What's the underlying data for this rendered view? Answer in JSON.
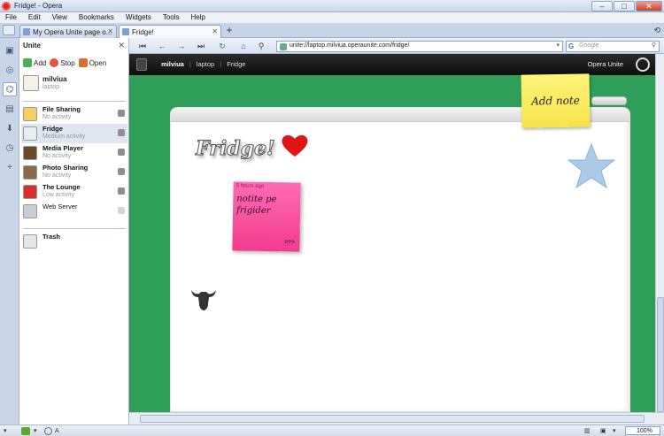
{
  "window": {
    "title": "Fridge! - Opera"
  },
  "menu": [
    "File",
    "Edit",
    "View",
    "Bookmarks",
    "Widgets",
    "Tools",
    "Help"
  ],
  "tabs": [
    {
      "label": "My Opera Unite page o...",
      "active": false
    },
    {
      "label": "Fridge!",
      "active": true
    }
  ],
  "panel": {
    "title": "Unite",
    "toolbar": {
      "add": "Add",
      "stop": "Stop",
      "open": "Open"
    },
    "owner": {
      "name": "milviua",
      "device": "laptop"
    },
    "services": [
      {
        "name": "File Sharing",
        "status": "No activity"
      },
      {
        "name": "Fridge",
        "status": "Medium activity"
      },
      {
        "name": "Media Player",
        "status": "No activity"
      },
      {
        "name": "Photo Sharing",
        "status": "No activity"
      },
      {
        "name": "The Lounge",
        "status": "Low activity"
      },
      {
        "name": "Web Server",
        "status": ""
      }
    ],
    "trash": "Trash"
  },
  "address": {
    "url": "unite://laptop.milviua.operaunite.com/fridge/",
    "search_placeholder": "Google"
  },
  "page": {
    "crumbs": [
      "milviua",
      "laptop",
      "Fridge"
    ],
    "brand": "Opera Unite",
    "fridge_title": "Fridge!",
    "add_note": "Add note",
    "note": {
      "time": "5 hours ago",
      "text": "notite pe frigider",
      "sign": "???"
    }
  },
  "status": {
    "zoom": "100%",
    "left_label": "A"
  }
}
